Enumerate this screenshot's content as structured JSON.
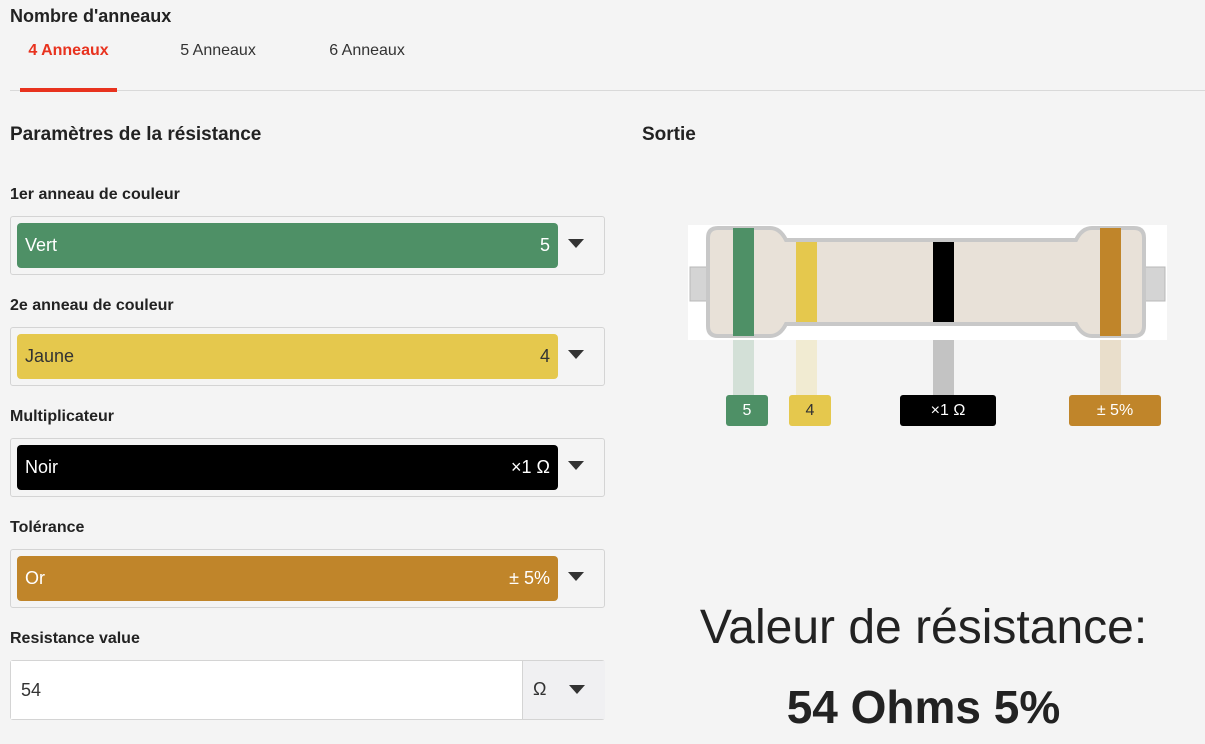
{
  "ring_count": {
    "title": "Nombre d'anneaux",
    "tabs": [
      {
        "label": "4 Anneaux",
        "active": true
      },
      {
        "label": "5 Anneaux",
        "active": false
      },
      {
        "label": "6 Anneaux",
        "active": false
      }
    ]
  },
  "params": {
    "title": "Paramètres de la résistance",
    "bands": [
      {
        "label": "1er anneau de couleur",
        "color_name": "Vert",
        "value": "5",
        "color": "#4e9066",
        "text_color": "#ffffff"
      },
      {
        "label": "2e anneau de couleur",
        "color_name": "Jaune",
        "value": "4",
        "color": "#e5c84d",
        "text_color": "#333333"
      },
      {
        "label": "Multiplicateur",
        "color_name": "Noir",
        "value": "×1 Ω",
        "color": "#000000",
        "text_color": "#ffffff"
      },
      {
        "label": "Tolérance",
        "color_name": "Or",
        "value": "± 5%",
        "color": "#c0852a",
        "text_color": "#ffffff"
      }
    ],
    "resistance": {
      "label": "Resistance value",
      "value": "54",
      "unit": "Ω"
    }
  },
  "output": {
    "title": "Sortie",
    "band_labels": [
      "5",
      "4",
      "×1 Ω",
      "± 5%"
    ],
    "result_title": "Valeur de résistance:",
    "result_value": "54 Ohms 5%"
  },
  "colors": {
    "accent": "#e8321e",
    "resistor_body": "#e8e1d8",
    "resistor_outline": "#c8c8c8"
  }
}
